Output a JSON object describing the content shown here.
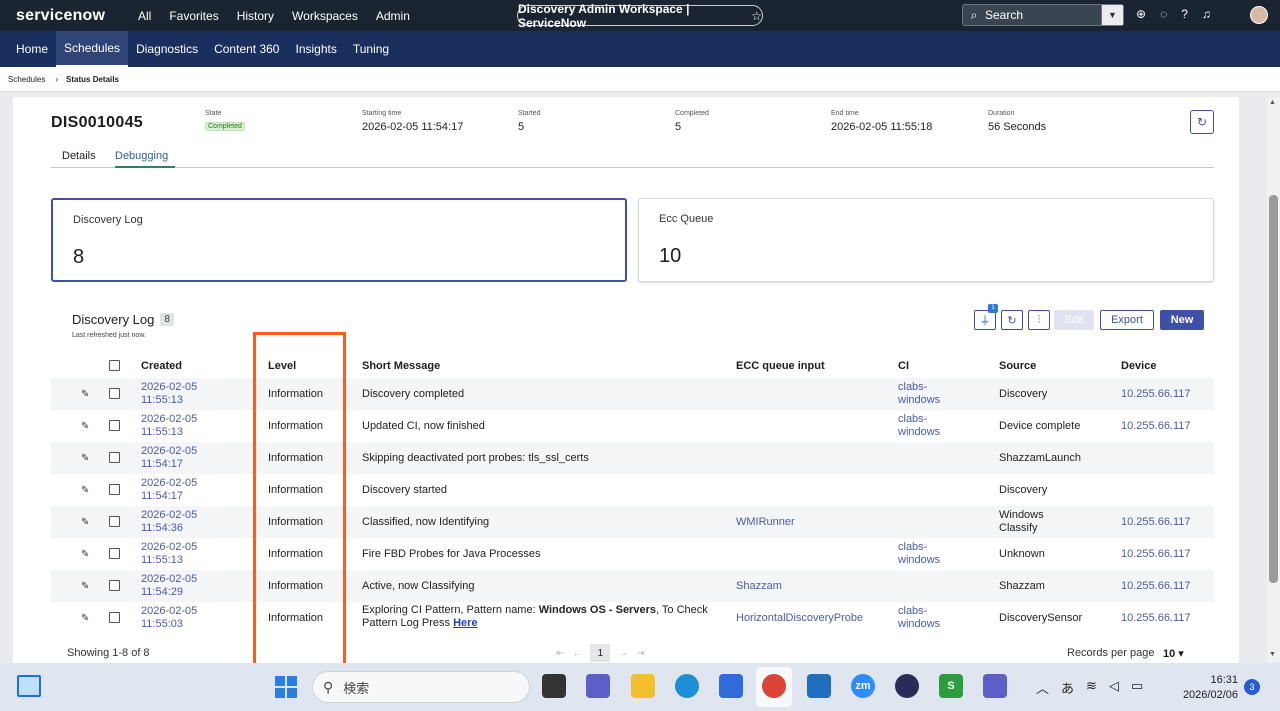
{
  "top_nav": {
    "logo": "servicenow",
    "menu": [
      "All",
      "Favorites",
      "History",
      "Workspaces",
      "Admin"
    ],
    "workspace_title": "Discovery Admin Workspace | ServiceNow",
    "search_placeholder": "Search"
  },
  "sub_nav": [
    "Home",
    "Schedules",
    "Diagnostics",
    "Content 360",
    "Insights",
    "Tuning"
  ],
  "sub_nav_active": "Schedules",
  "breadcrumb": {
    "parent": "Schedules",
    "current": "Status Details"
  },
  "record": {
    "number": "DIS0010045",
    "state_label": "State",
    "state": "Completed",
    "starting_time_label": "Starting time",
    "starting_time": "2026-02-05 11:54:17",
    "started_label": "Started",
    "started": "5",
    "completed_label": "Completed",
    "completed": "5",
    "end_time_label": "End time",
    "end_time": "2026-02-05 11:55:18",
    "duration_label": "Duration",
    "duration": "56 Seconds"
  },
  "tabs": [
    "Details",
    "Debugging"
  ],
  "active_tab": "Debugging",
  "kpis": [
    {
      "label": "Discovery Log",
      "value": "8"
    },
    {
      "label": "Ecc Queue",
      "value": "10"
    }
  ],
  "list": {
    "title": "Discovery Log",
    "count": "8",
    "refreshed": "Last refreshed just now.",
    "filter_badge": "1",
    "buttons": {
      "edit": "Edit",
      "export": "Export",
      "new": "New"
    },
    "columns": [
      "Created",
      "Level",
      "Short Message",
      "ECC queue input",
      "CI",
      "Source",
      "Device"
    ],
    "rows": [
      {
        "created": [
          "2026-02-05",
          "11:55:13"
        ],
        "level": "Information",
        "message": "Discovery completed",
        "ecc": "",
        "ci": [
          "clabs-",
          "windows"
        ],
        "source": [
          "Discovery"
        ],
        "device": "10.255.66.117"
      },
      {
        "created": [
          "2026-02-05",
          "11:55:13"
        ],
        "level": "Information",
        "message": "Updated CI, now finished",
        "ecc": "",
        "ci": [
          "clabs-",
          "windows"
        ],
        "source": [
          "Device complete"
        ],
        "device": "10.255.66.117"
      },
      {
        "created": [
          "2026-02-05",
          "11:54:17"
        ],
        "level": "Information",
        "message": "Skipping deactivated port probes: tls_ssl_certs",
        "ecc": "",
        "ci": [],
        "source": [
          "ShazzamLaunch"
        ],
        "device": ""
      },
      {
        "created": [
          "2026-02-05",
          "11:54:17"
        ],
        "level": "Information",
        "message": "Discovery started",
        "ecc": "",
        "ci": [],
        "source": [
          "Discovery"
        ],
        "device": ""
      },
      {
        "created": [
          "2026-02-05",
          "11:54:36"
        ],
        "level": "Information",
        "message": "Classified, now Identifying",
        "ecc": "WMIRunner",
        "ci": [],
        "source": [
          "Windows",
          "Classify"
        ],
        "device": "10.255.66.117"
      },
      {
        "created": [
          "2026-02-05",
          "11:55:13"
        ],
        "level": "Information",
        "message": "Fire FBD Probes for Java Processes",
        "ecc": "",
        "ci": [
          "clabs-",
          "windows"
        ],
        "source": [
          "Unknown"
        ],
        "device": "10.255.66.117"
      },
      {
        "created": [
          "2026-02-05",
          "11:54:29"
        ],
        "level": "Information",
        "message": "Active, now Classifying",
        "ecc": "Shazzam",
        "ci": [],
        "source": [
          "Shazzam"
        ],
        "device": "10.255.66.117"
      },
      {
        "created": [
          "2026-02-05",
          "11:55:03"
        ],
        "level": "Information",
        "message": "",
        "message_parts": [
          "Exploring CI Pattern, Pattern name: ",
          "Windows OS - Servers",
          ", To Check",
          "Pattern Log Press ",
          "Here"
        ],
        "ecc": "HorizontalDiscoveryProbe",
        "ci": [
          "clabs-",
          "windows"
        ],
        "source": [
          "DiscoverySensor"
        ],
        "device": "10.255.66.117"
      }
    ],
    "showing": "Showing 1-8 of 8",
    "current_page": "1",
    "records_per_page_label": "Records per page",
    "records_per_page": "10"
  },
  "taskbar": {
    "search_text": "検索",
    "time": "16:31",
    "date": "2026/02/06",
    "notification_count": "3",
    "ime": "あ"
  },
  "colors": {
    "top_bar": "#1b2431",
    "sub_nav": "#1b2f5e",
    "accent": "#3f4fa8",
    "highlight": "#ff5a1f"
  }
}
